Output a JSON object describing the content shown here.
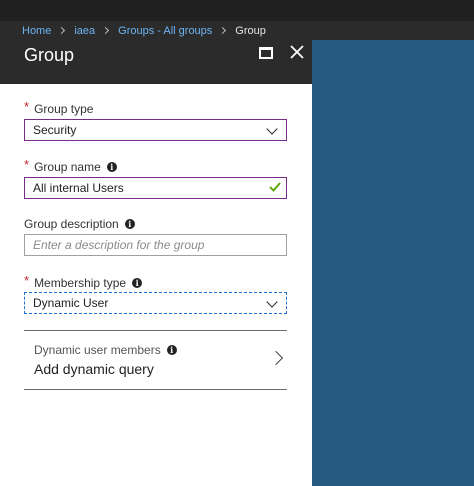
{
  "breadcrumb": {
    "items": [
      "Home",
      "iaea",
      "Groups - All groups"
    ],
    "current": "Group"
  },
  "blade": {
    "title": "Group"
  },
  "form": {
    "group_type": {
      "label": "Group type",
      "value": "Security"
    },
    "group_name": {
      "label": "Group name",
      "value": "All internal Users"
    },
    "group_description": {
      "label": "Group description",
      "placeholder": "Enter a description for the group"
    },
    "membership_type": {
      "label": "Membership type",
      "value": "Dynamic User"
    },
    "dynamic_members": {
      "label": "Dynamic user members",
      "action": "Add dynamic query"
    }
  },
  "colors": {
    "accent_panel": "#245a7d",
    "header_bg": "#2b2b2b",
    "required_star": "#c4262e",
    "valid_check": "#57a300",
    "link": "#6cb4f2"
  },
  "icons": [
    "maximize-icon",
    "close-icon",
    "info-icon",
    "chevron-down-icon",
    "checkmark-icon",
    "chevron-right-icon"
  ]
}
